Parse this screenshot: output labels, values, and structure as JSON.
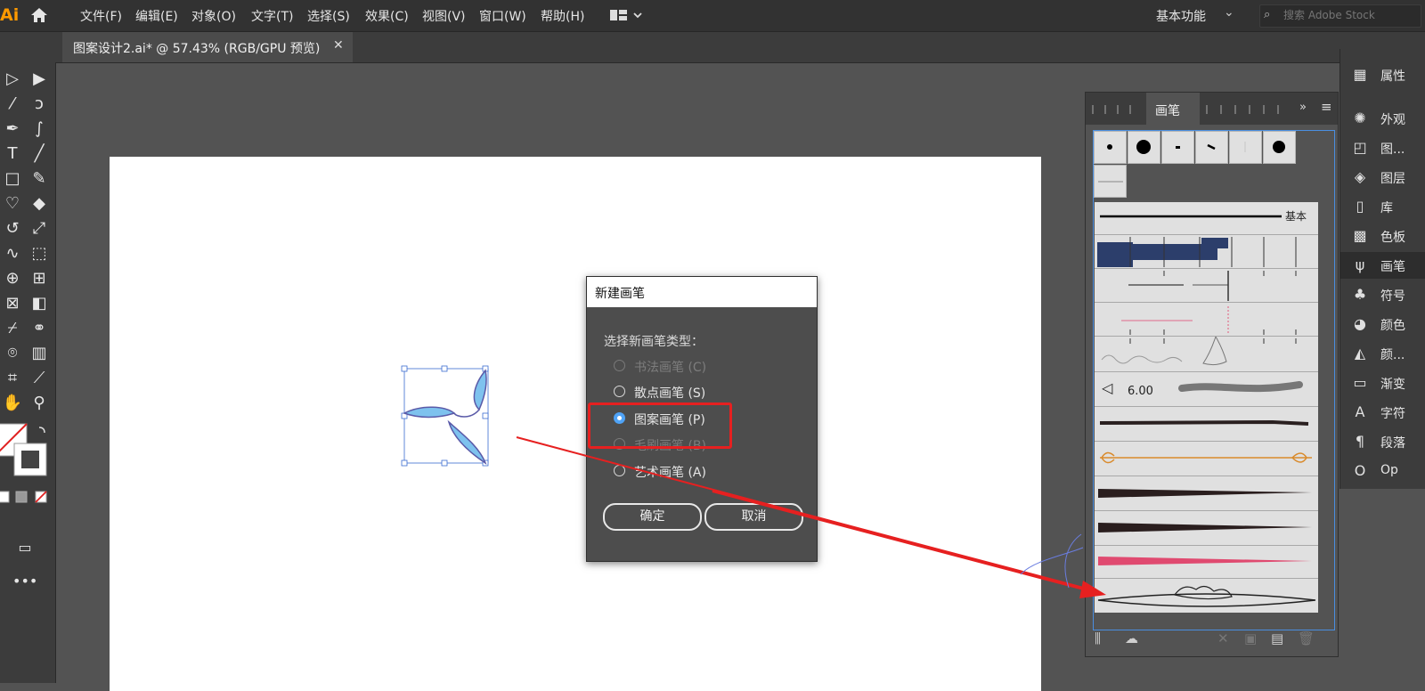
{
  "app": {
    "logo": "Ai"
  },
  "menu": [
    "文件(F)",
    "编辑(E)",
    "对象(O)",
    "文字(T)",
    "选择(S)",
    "效果(C)",
    "视图(V)",
    "窗口(W)",
    "帮助(H)"
  ],
  "workspace": "基本功能",
  "search": {
    "placeholder": "搜索 Adobe Stock"
  },
  "document_tab": {
    "label": "图案设计2.ai* @ 57.43% (RGB/GPU 预览)",
    "close": "✕"
  },
  "dialog": {
    "title": "新建画笔",
    "prompt": "选择新画笔类型：",
    "options": [
      {
        "label": "书法画笔 (C)",
        "enabled": false,
        "selected": false
      },
      {
        "label": "散点画笔 (S)",
        "enabled": true,
        "selected": false
      },
      {
        "label": "图案画笔 (P)",
        "enabled": true,
        "selected": true
      },
      {
        "label": "毛刷画笔 (B)",
        "enabled": false,
        "selected": false
      },
      {
        "label": "艺术画笔 (A)",
        "enabled": true,
        "selected": false
      }
    ],
    "ok": "确定",
    "cancel": "取消"
  },
  "brush_panel": {
    "active_tab": "画笔",
    "basic_label": "基本",
    "brush_size": "6.00"
  },
  "dock": [
    {
      "label": "属性",
      "icon": "properties-icon"
    },
    {
      "label": "外观",
      "icon": "appearance-icon"
    },
    {
      "label": "图...",
      "icon": "graphic-styles-icon"
    },
    {
      "label": "图层",
      "icon": "layers-icon"
    },
    {
      "label": "库",
      "icon": "libraries-icon"
    },
    {
      "label": "色板",
      "icon": "swatches-icon"
    },
    {
      "label": "画笔",
      "icon": "brushes-icon",
      "active": true
    },
    {
      "label": "符号",
      "icon": "symbols-icon"
    },
    {
      "label": "颜色",
      "icon": "color-icon"
    },
    {
      "label": "颜...",
      "icon": "color-guide-icon"
    },
    {
      "label": "渐变",
      "icon": "gradient-icon"
    },
    {
      "label": "字符",
      "icon": "character-icon"
    },
    {
      "label": "段落",
      "icon": "paragraph-icon"
    },
    {
      "label": "Op",
      "icon": "opentype-icon"
    }
  ],
  "colors": {
    "accent": "#4fa3f7",
    "highlight": "#e62020",
    "panel": "#535353",
    "chrome": "#323232"
  }
}
